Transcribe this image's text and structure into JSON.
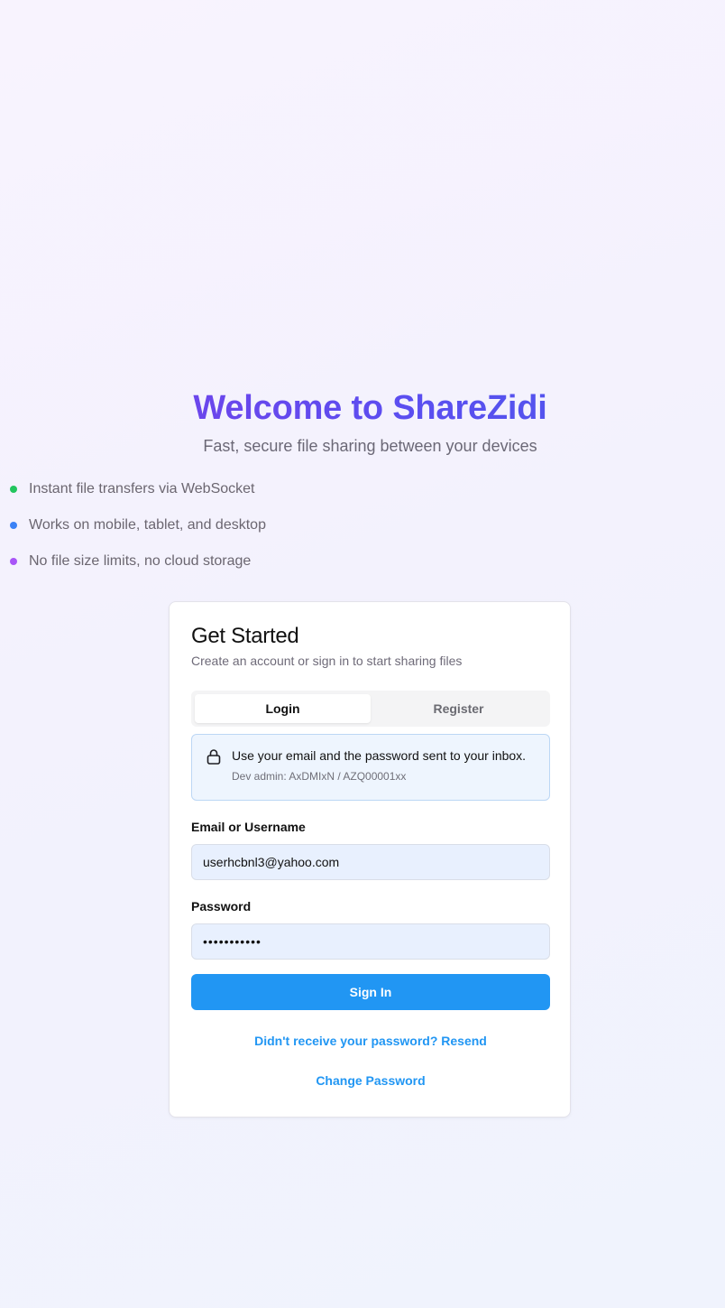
{
  "hero": {
    "title": "Welcome to ShareZidi",
    "subtitle": "Fast, secure file sharing between your devices"
  },
  "features": [
    {
      "text": "Instant file transfers via WebSocket",
      "dot_color": "#22c55e"
    },
    {
      "text": "Works on mobile, tablet, and desktop",
      "dot_color": "#3b82f6"
    },
    {
      "text": "No file size limits, no cloud storage",
      "dot_color": "#a855f7"
    }
  ],
  "card": {
    "title": "Get Started",
    "description": "Create an account or sign in to start sharing files",
    "tabs": {
      "login": "Login",
      "register": "Register",
      "active": "login"
    },
    "notice": {
      "icon": "lock-icon",
      "text": "Use your email and the password sent to your inbox.",
      "subtext": "Dev admin: AxDMIxN / AZQ00001xx"
    },
    "email": {
      "label": "Email or Username",
      "value": "userhcbnl3@yahoo.com"
    },
    "password": {
      "label": "Password",
      "value": "•••••••••••"
    },
    "sign_in_label": "Sign In",
    "resend_link": "Didn't receive your password? Resend",
    "change_password_link": "Change Password"
  },
  "colors": {
    "accent": "#2196f3",
    "title_gradient_start": "#7a3ee8",
    "title_gradient_end": "#4b5bea"
  }
}
